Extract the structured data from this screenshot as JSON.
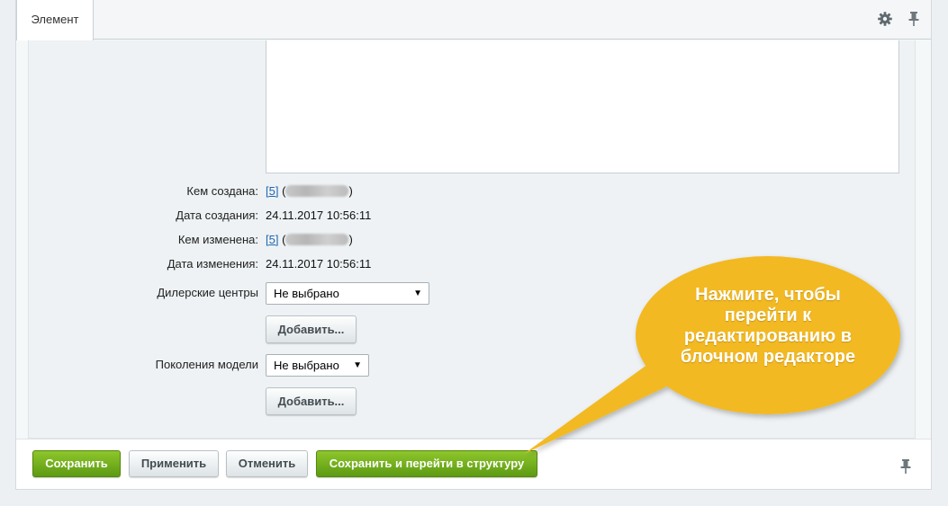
{
  "tab": {
    "label": "Элемент"
  },
  "fields": {
    "created_by": {
      "label": "Кем создана:",
      "link": "[5]",
      "open": "(",
      "close": ")"
    },
    "created_date": {
      "label": "Дата создания:",
      "value": "24.11.2017 10:56:11"
    },
    "modified_by": {
      "label": "Кем изменена:",
      "link": "[5]",
      "open": "(",
      "close": ")"
    },
    "modified_date": {
      "label": "Дата изменения:",
      "value": "24.11.2017 10:56:11"
    },
    "dealers": {
      "label": "Дилерские центры",
      "selected": "Не выбрано",
      "add_label": "Добавить..."
    },
    "generations": {
      "label": "Поколения модели",
      "selected": "Не выбрано",
      "add_label": "Добавить..."
    }
  },
  "footer": {
    "save": "Сохранить",
    "apply": "Применить",
    "cancel": "Отменить",
    "save_structure": "Сохранить и перейти в структуру"
  },
  "callout": {
    "text": "Нажмите, чтобы перейти к редактированию в блочном редакторе",
    "color": "#f2b922"
  },
  "icons": {
    "settings": "gear-icon",
    "pin_top": "pin-icon",
    "pin_bottom": "pin-icon"
  }
}
